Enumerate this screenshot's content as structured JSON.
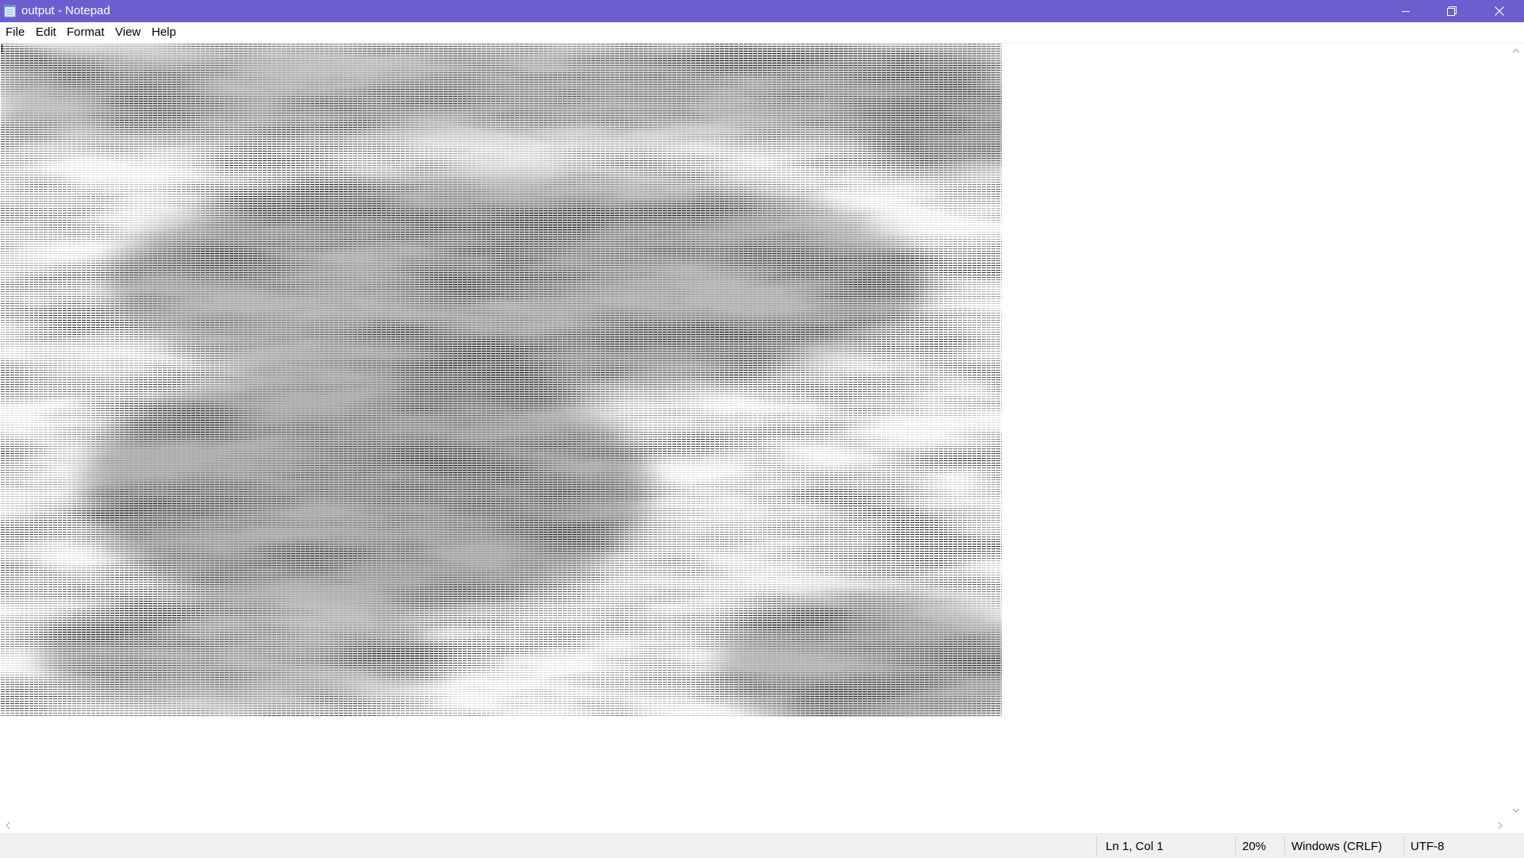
{
  "window": {
    "title": "output - Notepad"
  },
  "menu": {
    "items": [
      {
        "label": "File"
      },
      {
        "label": "Edit"
      },
      {
        "label": "Format"
      },
      {
        "label": "View"
      },
      {
        "label": "Help"
      }
    ]
  },
  "editor": {
    "content_description_icon": "ascii-art-image"
  },
  "statusbar": {
    "position": "Ln 1, Col 1",
    "zoom": "20%",
    "line_ending": "Windows (CRLF)",
    "encoding": "UTF-8"
  },
  "colors": {
    "titlebar": "#6b5fcf",
    "statusbar": "#f0f0f0",
    "text": "#000000"
  }
}
